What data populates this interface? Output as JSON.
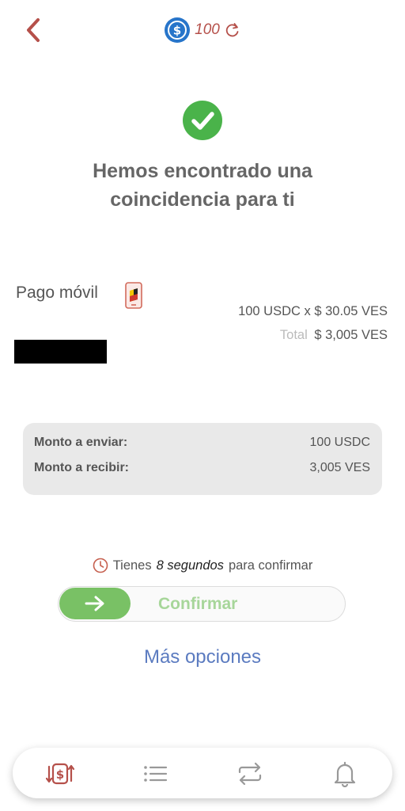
{
  "header": {
    "balance": "100"
  },
  "match": {
    "headline": "Hemos encontrado una coincidencia para ti"
  },
  "payment": {
    "method": "Pago móvil",
    "rate_line": "100 USDC x $ 30.05 VES",
    "total_label": "Total",
    "total_value": "$ 3,005 VES"
  },
  "summary": {
    "send_label": "Monto a enviar:",
    "send_value": "100 USDC",
    "receive_label": "Monto a recibir:",
    "receive_value": "3,005 VES"
  },
  "timer": {
    "prefix": "Tienes",
    "seconds": "8 segundos",
    "suffix": "para confirmar"
  },
  "confirm_label": "Confirmar",
  "more_options": "Más opciones",
  "colors": {
    "accent_red": "#b5504a",
    "success_green": "#4ab34a",
    "slider_green": "#79c165",
    "link_blue": "#5b7bc0",
    "coin_blue": "#2775ca"
  },
  "nav": {
    "items": [
      "exchange-icon",
      "list-icon",
      "transfer-icon",
      "bell-icon"
    ],
    "active": "exchange-icon"
  }
}
